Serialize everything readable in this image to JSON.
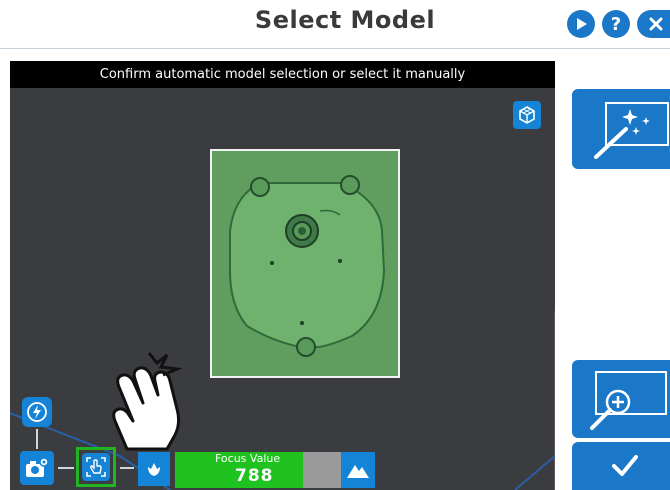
{
  "header": {
    "title": "Select Model",
    "play_icon": "play-icon",
    "help_label": "?",
    "close_icon": "close-icon"
  },
  "camera": {
    "banner_text": "Confirm automatic model selection or select it manually",
    "view_3d_icon": "cube-icon",
    "overlay_color": "#5f9e5e"
  },
  "toolbar": {
    "flash_icon": "flash-auto-icon",
    "camera_settings_icon": "camera-settings-icon",
    "manual_select_icon": "hand-select-icon",
    "tulip_icon": "macro-mode-icon",
    "landscape_icon": "landscape-mode-icon",
    "focus_label": "Focus Value",
    "focus_value": "788",
    "focus_level": 0.77
  },
  "side_panel": {
    "auto_select_icon": "magic-wand-icon",
    "zoom_icon": "zoom-in-icon",
    "confirm_icon": "checkmark-icon"
  },
  "colors": {
    "accent": "#1b78c8",
    "focus_good": "#1fc21f",
    "selection_border": "#22b422"
  }
}
